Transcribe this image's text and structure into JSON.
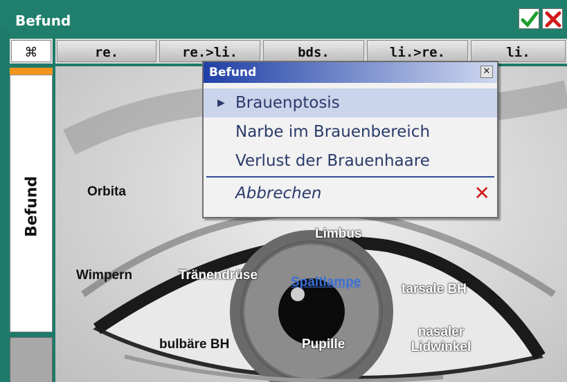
{
  "window": {
    "title": "Befund",
    "ok_icon": "checkmark-icon",
    "cancel_icon": "close-x-icon",
    "accent_color": "#1f7f6c"
  },
  "tabs": [
    {
      "label": "⌘",
      "icon": "command-icon"
    },
    {
      "label": "re."
    },
    {
      "label": "re.>li."
    },
    {
      "label": "bds."
    },
    {
      "label": "li.>re."
    },
    {
      "label": "li."
    }
  ],
  "sidebar": {
    "label": "Befund",
    "accent_color": "#f7941d"
  },
  "eye_labels": {
    "orbita": "Orbita",
    "limbus": "Limbus",
    "wimpern": "Wimpern",
    "traenendruese": "Tränendrüse",
    "spaltlampe": "Spaltlampe",
    "tarsale_bh": "tarsale BH",
    "bulbaere_bh": "bulbäre BH",
    "pupille": "Pupille",
    "nasaler": "nasaler",
    "lidwinkel": "Lidwinkel"
  },
  "popup": {
    "title": "Befund",
    "close_icon": "close-icon",
    "items": [
      {
        "label": "Brauenptosis",
        "selected": true
      },
      {
        "label": "Narbe im Brauenbereich",
        "selected": false
      },
      {
        "label": "Verlust der Brauenhaare",
        "selected": false
      }
    ],
    "cancel_label": "Abbrechen",
    "cancel_icon": "close-x-icon",
    "selected_color": "#cad4ea",
    "title_color": "#1e3fa6"
  }
}
